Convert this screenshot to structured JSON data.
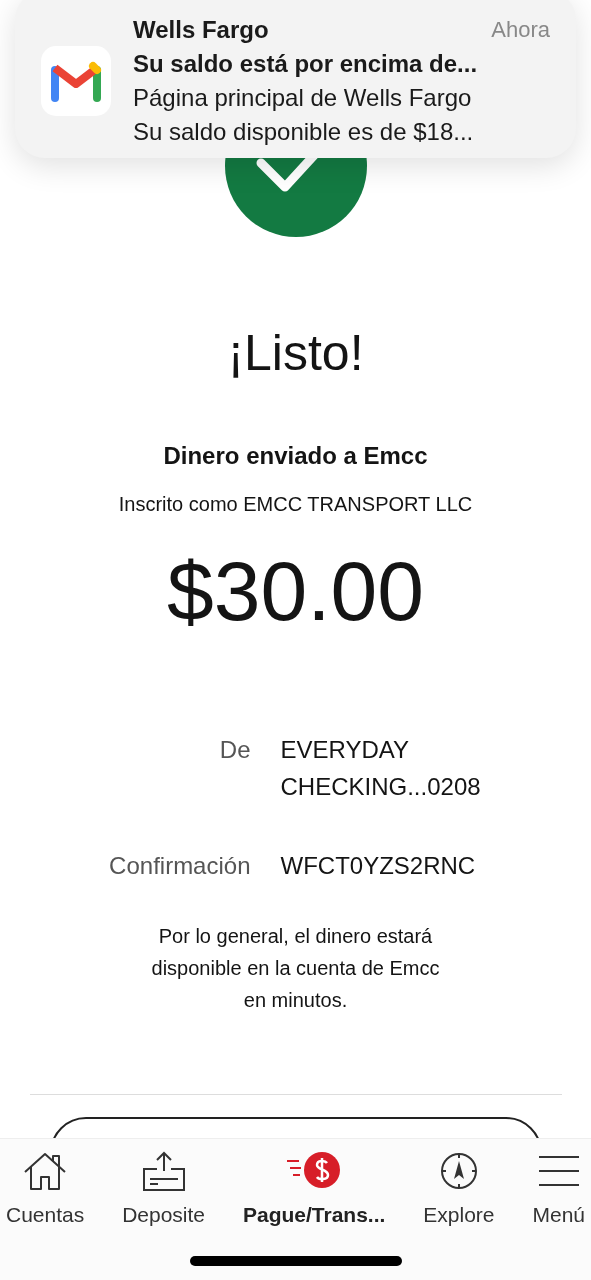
{
  "notification": {
    "app": "Wells Fargo",
    "time": "Ahora",
    "subject": "Su saldo está por encima de...",
    "line_1": "Página principal de Wells Fargo",
    "line_2": "Su saldo disponible es de $18..."
  },
  "result": {
    "title": "¡Listo!",
    "heading": "Dinero enviado a Emcc",
    "subheading": "Inscrito como EMCC TRANSPORT LLC",
    "amount": "$30.00"
  },
  "details": [
    {
      "label": "De",
      "value": "EVERYDAY CHECKING...0208"
    },
    {
      "label": "Confirmación",
      "value": "WFCT0YZS2RNC"
    }
  ],
  "note": "Por lo general, el dinero estará disponible en la cuenta de Emcc en minutos.",
  "tab_bar": [
    {
      "kind": "home",
      "label": "Cuentas",
      "selected": false
    },
    {
      "kind": "deposit",
      "label": "Deposite",
      "selected": false
    },
    {
      "kind": "pay",
      "label": "Pague/Trans...",
      "selected": true
    },
    {
      "kind": "explore",
      "label": "Explore",
      "selected": false
    },
    {
      "kind": "menu",
      "label": "Menú",
      "selected": false
    }
  ]
}
